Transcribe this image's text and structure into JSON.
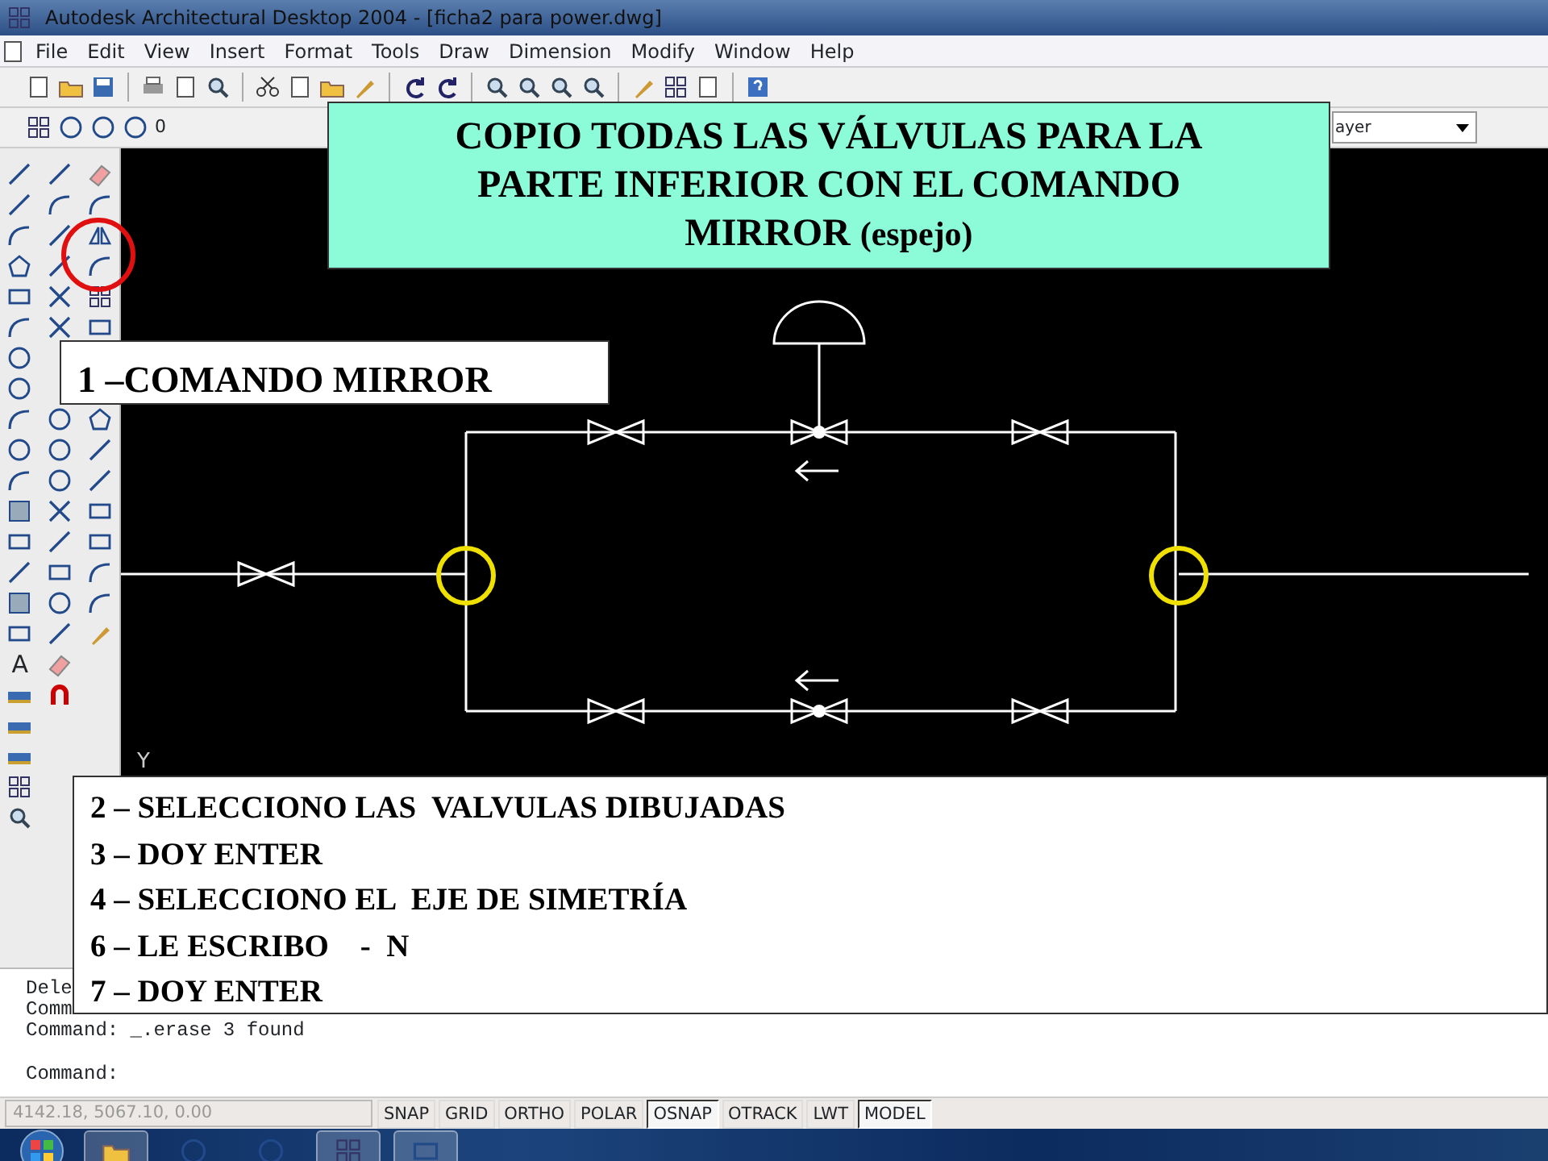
{
  "window": {
    "title": "Autodesk Architectural Desktop 2004 - [ficha2 para power.dwg]"
  },
  "menu": [
    "File",
    "Edit",
    "View",
    "Insert",
    "Format",
    "Tools",
    "Draw",
    "Dimension",
    "Modify",
    "Window",
    "Help"
  ],
  "layer_toolbar": {
    "layer": "0",
    "linetype_value": "ayer"
  },
  "left_toolbar": {
    "text_tool": "A"
  },
  "drawing": {
    "axis_label": "Y"
  },
  "callouts": {
    "title_lines": [
      "COPIO TODAS LAS VÁLVULAS PARA LA",
      "PARTE INFERIOR CON EL COMANDO",
      "MIRROR **(espejo)**"
    ],
    "step_one": "1 –COMANDO MIRROR",
    "steps": [
      "2 – SELECCIONO LAS  VALVULAS DIBUJADAS",
      "3 – DOY ENTER",
      "4 – SELECCIONO EL  EJE DE SIMETRÍA",
      "6 – LE ESCRIBO    -  N",
      "7 – DOY ENTER"
    ]
  },
  "command_window": {
    "history": [
      "Dele",
      "Comm",
      "Command: _.erase 3 found"
    ],
    "prompt": "Command:"
  },
  "status_bar": {
    "coordinates": "4142.18, 5067.10, 0.00",
    "toggles": [
      {
        "label": "SNAP",
        "on": false
      },
      {
        "label": "GRID",
        "on": false
      },
      {
        "label": "ORTHO",
        "on": false
      },
      {
        "label": "POLAR",
        "on": false
      },
      {
        "label": "OSNAP",
        "on": true
      },
      {
        "label": "OTRACK",
        "on": false
      },
      {
        "label": "LWT",
        "on": false
      },
      {
        "label": "MODEL",
        "on": true
      }
    ]
  }
}
